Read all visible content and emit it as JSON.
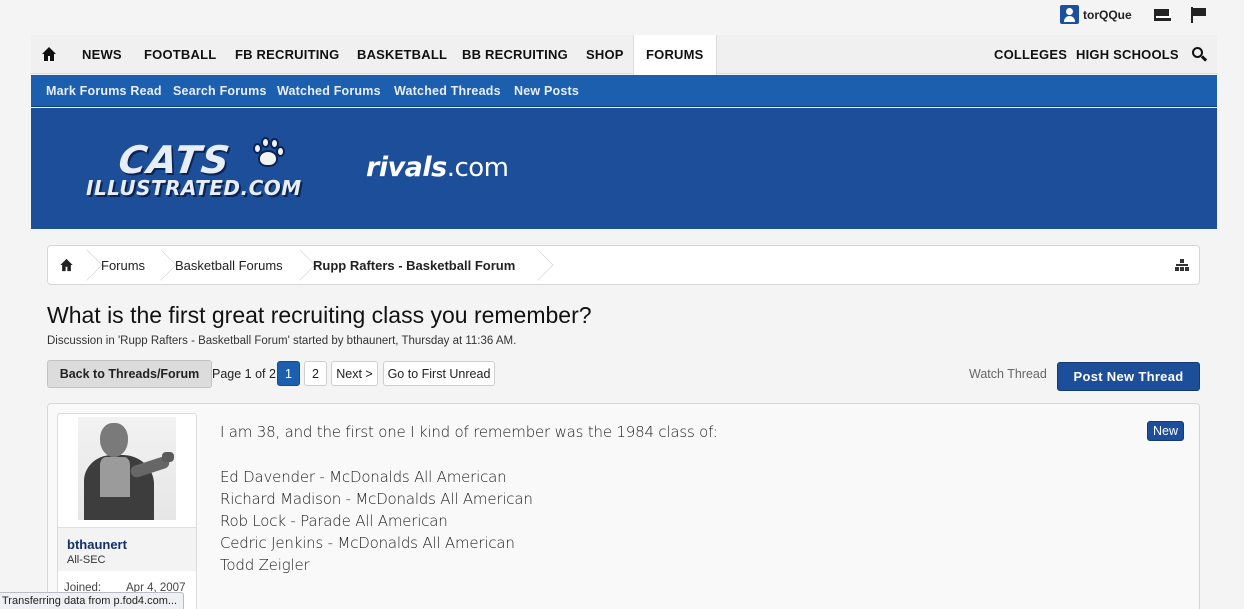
{
  "userbar": {
    "username": "torQQue"
  },
  "mainnav": {
    "items": [
      "NEWS",
      "FOOTBALL",
      "FB RECRUITING",
      "BASKETBALL",
      "BB RECRUITING",
      "SHOP",
      "FORUMS"
    ],
    "right_items": [
      "COLLEGES",
      "HIGH SCHOOLS"
    ],
    "active": "FORUMS"
  },
  "subnav": {
    "items": [
      "Mark Forums Read",
      "Search Forums",
      "Watched Forums",
      "Watched Threads",
      "New Posts"
    ]
  },
  "banner": {
    "logo_top": "CATS",
    "logo_bottom": "ILLUSTRATED.COM",
    "partner_bold": "rivals",
    "partner_suffix": ".com"
  },
  "breadcrumb": [
    "Forums",
    "Basketball Forums",
    "Rupp Rafters - Basketball Forum"
  ],
  "thread": {
    "title": "What is the first great recruiting class you remember?",
    "description": "Discussion in 'Rupp Rafters - Basketball Forum' started by bthaunert, Thursday at 11:36 AM."
  },
  "pagination": {
    "back_label": "Back to Threads/Forum",
    "page_label": "Page 1 of 2",
    "pages": [
      "1",
      "2"
    ],
    "current_page": "1",
    "next_label": "Next >",
    "first_unread_label": "Go to First Unread"
  },
  "actions": {
    "watch_label": "Watch Thread",
    "post_label": "Post New Thread"
  },
  "post": {
    "username": "bthaunert",
    "rank": "All-SEC",
    "joined_label": "Joined:",
    "joined_value": "Apr 4, 2007",
    "badge": "New",
    "lines": [
      "I am 38, and the first one I kind of remember was the 1984 class of:",
      "",
      "Ed Davender - McDonalds All American",
      "Richard Madison - McDonalds All American",
      "Rob Lock - Parade All American",
      "Cedric Jenkins - McDonalds All American",
      "Todd Zeigler"
    ]
  },
  "status": {
    "text": "Transferring data from p.fod4.com..."
  },
  "colors": {
    "brand_blue": "#1d4e9a",
    "subnav_blue": "#1c5fae"
  }
}
